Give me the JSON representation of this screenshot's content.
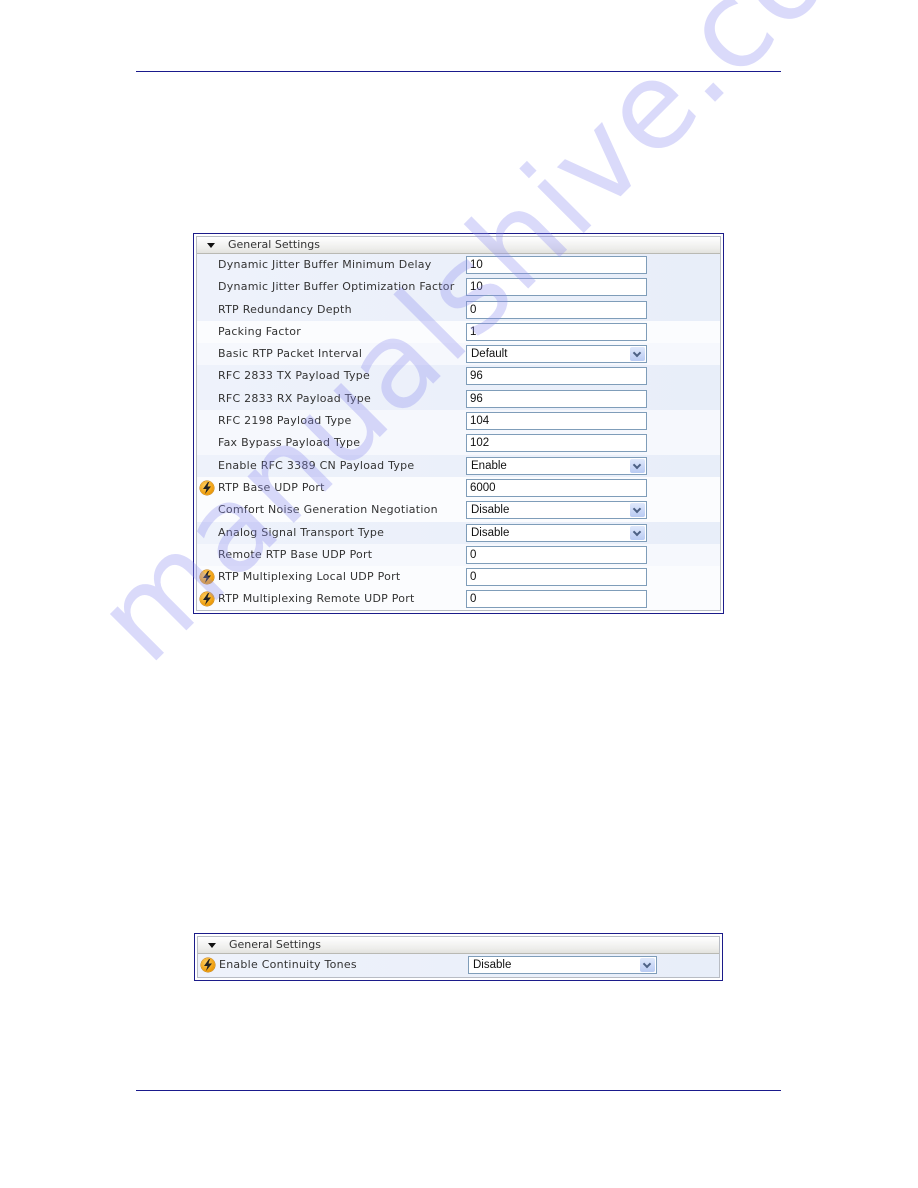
{
  "watermark": "manualshive.com",
  "panels": [
    {
      "title": "General Settings",
      "rows": [
        {
          "label": "Dynamic Jitter Buffer Minimum Delay",
          "type": "text",
          "value": "10",
          "bolt": false
        },
        {
          "label": "Dynamic Jitter Buffer Optimization Factor",
          "type": "text",
          "value": "10",
          "bolt": false
        },
        {
          "label": "RTP Redundancy Depth",
          "type": "text",
          "value": "0",
          "bolt": false
        },
        {
          "label": "Packing Factor",
          "type": "text",
          "value": "1",
          "bolt": false
        },
        {
          "label": "Basic RTP Packet Interval",
          "type": "select",
          "value": "Default",
          "bolt": false
        },
        {
          "label": "RFC 2833 TX Payload Type",
          "type": "text",
          "value": "96",
          "bolt": false
        },
        {
          "label": "RFC 2833 RX Payload Type",
          "type": "text",
          "value": "96",
          "bolt": false
        },
        {
          "label": "RFC 2198 Payload Type",
          "type": "text",
          "value": "104",
          "bolt": false
        },
        {
          "label": "Fax Bypass Payload Type",
          "type": "text",
          "value": "102",
          "bolt": false
        },
        {
          "label": "Enable RFC 3389 CN Payload Type",
          "type": "select",
          "value": "Enable",
          "bolt": false
        },
        {
          "label": "RTP Base UDP Port",
          "type": "text",
          "value": "6000",
          "bolt": true
        },
        {
          "label": "Comfort Noise Generation Negotiation",
          "type": "select",
          "value": "Disable",
          "bolt": false
        },
        {
          "label": "Analog Signal Transport Type",
          "type": "select",
          "value": "Disable",
          "bolt": false
        },
        {
          "label": "Remote RTP Base UDP Port",
          "type": "text",
          "value": "0",
          "bolt": false
        },
        {
          "label": "RTP Multiplexing Local UDP Port",
          "type": "text",
          "value": "0",
          "bolt": true
        },
        {
          "label": "RTP Multiplexing Remote UDP Port",
          "type": "text",
          "value": "0",
          "bolt": true
        }
      ]
    },
    {
      "title": "General Settings",
      "rows": [
        {
          "label": "Enable Continuity Tones",
          "type": "select",
          "value": "Disable",
          "bolt": true
        }
      ]
    }
  ]
}
